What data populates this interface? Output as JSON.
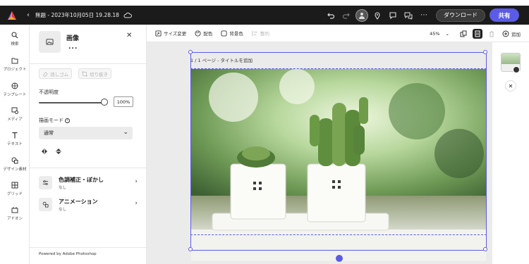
{
  "topbar": {
    "doc_title": "無題 - 2023年10月05日 19.28.18",
    "download_label": "ダウンロード",
    "share_label": "共有"
  },
  "rail": {
    "items": [
      {
        "label": "検索",
        "icon": "search-icon"
      },
      {
        "label": "プロジェクト",
        "icon": "folder-icon"
      },
      {
        "label": "テンプレート",
        "icon": "template-icon"
      },
      {
        "label": "メディア",
        "icon": "media-icon"
      },
      {
        "label": "テキスト",
        "icon": "text-icon"
      },
      {
        "label": "デザイン素材",
        "icon": "shapes-icon"
      },
      {
        "label": "グリッド",
        "icon": "grid-icon"
      },
      {
        "label": "アドオン",
        "icon": "addon-icon"
      }
    ]
  },
  "panel": {
    "title": "画像",
    "more": "...",
    "erase_label": "消しゴム",
    "crop_label": "切り抜き",
    "opacity_label": "不透明度",
    "opacity_value": "100%",
    "opacity_level": 1.0,
    "blend_label": "描画モード",
    "blend_value": "通常",
    "adjust_title": "色調補正・ぼかし",
    "adjust_sub": "なし",
    "anim_title": "アニメーション",
    "anim_sub": "なし",
    "powered": "Powered by Adobe Photoshop"
  },
  "toolbar": {
    "resize": "サイズ変更",
    "color": "配色",
    "background": "背景色",
    "arrange": "整列",
    "zoom": "45%",
    "add": "追加"
  },
  "canvas": {
    "page_label": "1 / 1 ページ - タイトルを追加"
  }
}
